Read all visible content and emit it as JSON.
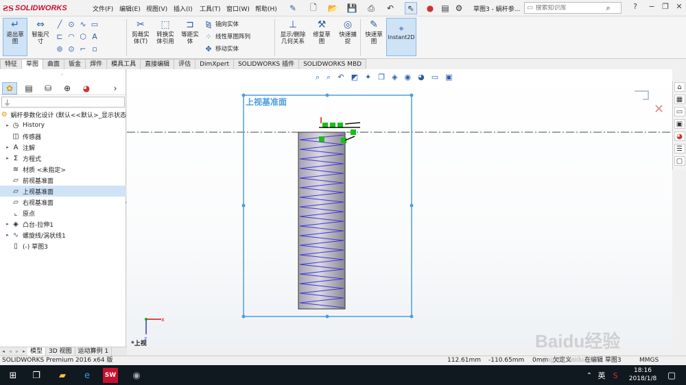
{
  "app": {
    "brand": "SOLIDWORKS",
    "menu": [
      "文件(F)",
      "编辑(E)",
      "视图(V)",
      "插入(I)",
      "工具(T)",
      "窗口(W)",
      "帮助(H)"
    ],
    "document_title": "草图3 - 蜗杆参...",
    "search_placeholder": "搜索知识库"
  },
  "command_manager": {
    "exit_sketch": "退出草图",
    "smart_dimension": "智能尺寸",
    "trim_entities": "剪裁实体(T)",
    "convert_entities": "转换实体引用",
    "offset_entities": "等距实体",
    "mirror_entities": "镜向实体",
    "linear_pattern": "线性草图阵列",
    "move_entities": "移动实体",
    "display_delete_relations": "显示/删除几何关系",
    "repair_sketch": "修复草图",
    "quick_snaps": "快速捕捉",
    "rapid_sketch": "快速草图",
    "instant2d": "Instant2D"
  },
  "tabs": [
    "特征",
    "草图",
    "曲面",
    "钣金",
    "焊件",
    "模具工具",
    "直接编辑",
    "评估",
    "DimXpert",
    "SOLIDWORKS 插件",
    "SOLIDWORKS MBD"
  ],
  "active_tab": "草图",
  "tree": {
    "root": "蜗杆参数化设计 (默认<<默认>_显示状态",
    "items": [
      {
        "label": "History",
        "icon": "history-icon",
        "expand": true
      },
      {
        "label": "传感器",
        "icon": "sensor-icon",
        "expand": false
      },
      {
        "label": "注解",
        "icon": "annotation-icon",
        "expand": true
      },
      {
        "label": "方程式",
        "icon": "equation-icon",
        "expand": true
      },
      {
        "label": "材质 <未指定>",
        "icon": "material-icon",
        "expand": false
      },
      {
        "label": "前视基准面",
        "icon": "plane-icon",
        "expand": false
      },
      {
        "label": "上视基准面",
        "icon": "plane-icon",
        "expand": false,
        "selected": true
      },
      {
        "label": "右视基准面",
        "icon": "plane-icon",
        "expand": false
      },
      {
        "label": "原点",
        "icon": "origin-icon",
        "expand": false
      },
      {
        "label": "凸台-拉伸1",
        "icon": "boss-extrude-icon",
        "expand": true
      },
      {
        "label": "螺旋线/涡状线1",
        "icon": "helix-icon",
        "expand": true
      },
      {
        "label": "(-) 草图3",
        "icon": "sketch-icon",
        "expand": false
      }
    ]
  },
  "viewport": {
    "plane_label": "上视基准面",
    "view_label": "*上视",
    "axis_x": "x",
    "axis_z": "z",
    "helix_turns": 18
  },
  "bottom_tabs": [
    "模型",
    "3D 视图",
    "运动算例 1"
  ],
  "status": {
    "product": "SOLIDWORKS Premium 2016 x64 版",
    "x": "112.61mm",
    "y": "-110.65mm",
    "z": "0mm",
    "state": "欠定义",
    "editing": "在编辑 草图3",
    "units": "MMGS"
  },
  "taskbar": {
    "time": "18:16",
    "date": "2018/1/8",
    "lang": "英"
  },
  "watermark": {
    "text": "Baidu经验",
    "url": "jingyan.baidu.com"
  },
  "colors": {
    "accent": "#2a5ea8",
    "plane": "#4a9ee0",
    "helix": "#3a3ad8",
    "brand": "#c8102e"
  }
}
